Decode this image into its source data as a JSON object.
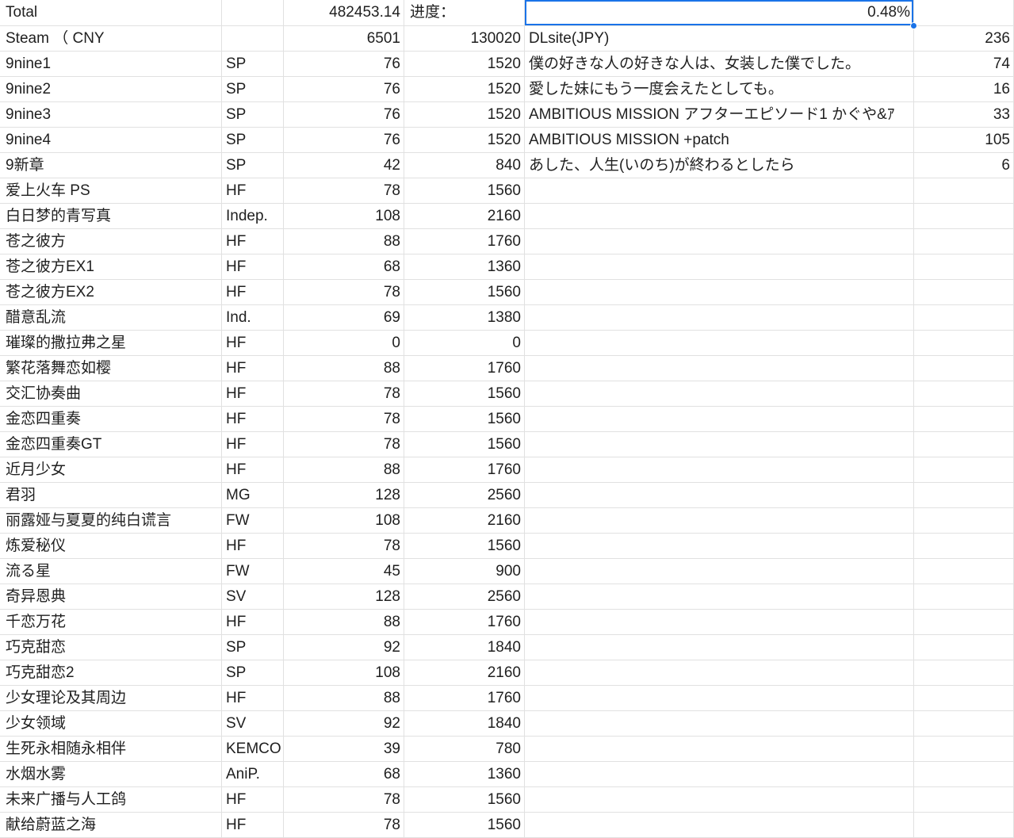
{
  "header": {
    "total_label": "Total",
    "total_blank": "",
    "total_value": "482453.14",
    "progress_label": "进度：",
    "progress_value": "0.48%",
    "progress_blank": ""
  },
  "columns": [
    "name",
    "type",
    "price_cny",
    "points",
    "dlsite_title",
    "dlsite_price"
  ],
  "rows": [
    [
      "Steam （ CNY",
      "",
      "6501",
      "130020",
      "DLsite(JPY)",
      "236"
    ],
    [
      "9nine1",
      "SP",
      "76",
      "1520",
      "僕の好きな人の好きな人は、女装した僕でした。",
      "74"
    ],
    [
      "9nine2",
      "SP",
      "76",
      "1520",
      "愛した妹にもう一度会えたとしても。",
      "16"
    ],
    [
      "9nine3",
      "SP",
      "76",
      "1520",
      "AMBITIOUS MISSION アフターエピソード1 かぐや&ｱ",
      "33"
    ],
    [
      "9nine4",
      "SP",
      "76",
      "1520",
      "AMBITIOUS MISSION  +patch",
      "105"
    ],
    [
      "9新章",
      "SP",
      "42",
      "840",
      "あした、人生(いのち)が終わるとしたら",
      "6"
    ],
    [
      "爱上火车 PS",
      "HF",
      "78",
      "1560",
      "",
      ""
    ],
    [
      "白日梦的青写真",
      "Indep.",
      "108",
      "2160",
      "",
      ""
    ],
    [
      "苍之彼方",
      "HF",
      "88",
      "1760",
      "",
      ""
    ],
    [
      "苍之彼方EX1",
      "HF",
      "68",
      "1360",
      "",
      ""
    ],
    [
      "苍之彼方EX2",
      "HF",
      "78",
      "1560",
      "",
      ""
    ],
    [
      "醋意乱流",
      "Ind.",
      "69",
      "1380",
      "",
      ""
    ],
    [
      "璀璨的撒拉弗之星",
      "HF",
      "0",
      "0",
      "",
      ""
    ],
    [
      "繁花落舞恋如樱",
      "HF",
      "88",
      "1760",
      "",
      ""
    ],
    [
      "交汇协奏曲",
      "HF",
      "78",
      "1560",
      "",
      ""
    ],
    [
      "金恋四重奏",
      "HF",
      "78",
      "1560",
      "",
      ""
    ],
    [
      "金恋四重奏GT",
      "HF",
      "78",
      "1560",
      "",
      ""
    ],
    [
      "近月少女",
      "HF",
      "88",
      "1760",
      "",
      ""
    ],
    [
      "君羽",
      "MG",
      "128",
      "2560",
      "",
      ""
    ],
    [
      "丽露娅与夏夏的纯白谎言",
      "FW",
      "108",
      "2160",
      "",
      ""
    ],
    [
      "炼爱秘仪",
      "HF",
      "78",
      "1560",
      "",
      ""
    ],
    [
      "流る星",
      "FW",
      "45",
      "900",
      "",
      ""
    ],
    [
      "奇异恩典",
      "SV",
      "128",
      "2560",
      "",
      ""
    ],
    [
      "千恋万花",
      "HF",
      "88",
      "1760",
      "",
      ""
    ],
    [
      "巧克甜恋",
      "SP",
      "92",
      "1840",
      "",
      ""
    ],
    [
      "巧克甜恋2",
      "SP",
      "108",
      "2160",
      "",
      ""
    ],
    [
      "少女理论及其周边",
      "HF",
      "88",
      "1760",
      "",
      ""
    ],
    [
      "少女领域",
      "SV",
      "92",
      "1840",
      "",
      ""
    ],
    [
      "生死永相随永相伴",
      "KEMCO",
      "39",
      "780",
      "",
      ""
    ],
    [
      "水烟水雾",
      "AniP.",
      "68",
      "1360",
      "",
      ""
    ],
    [
      "未来广播与人工鸽",
      "HF",
      "78",
      "1560",
      "",
      ""
    ],
    [
      "献给蔚蓝之海",
      "HF",
      "78",
      "1560",
      "",
      ""
    ]
  ],
  "colors": {
    "gridline": "#e1e1e1",
    "selection": "#1a73e8",
    "text": "#1f1f1f"
  }
}
